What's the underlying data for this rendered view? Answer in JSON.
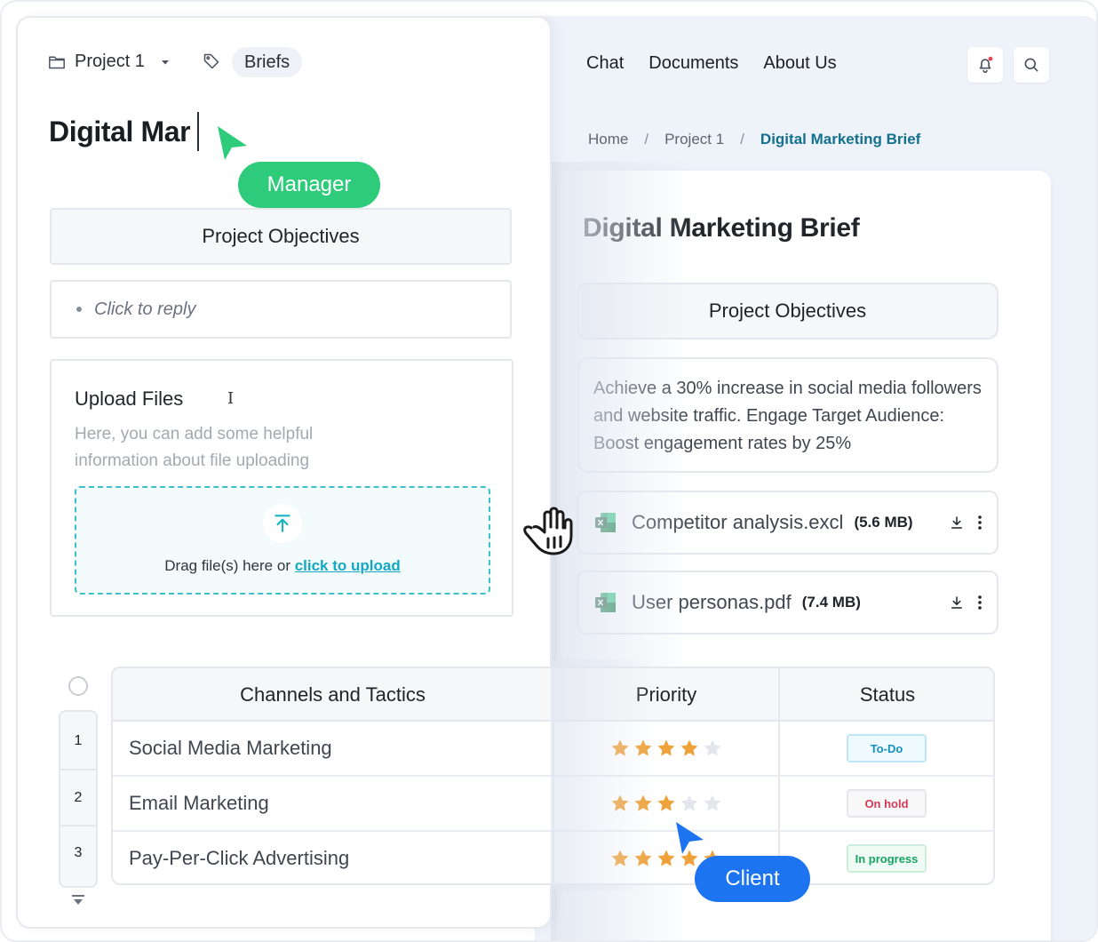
{
  "manager_view": {
    "project_selector": {
      "label": "Project 1"
    },
    "tag": {
      "label": "Briefs"
    },
    "title_input": {
      "value": "Digital Mar"
    },
    "cursor_badge": {
      "label": "Manager",
      "color": "#2ecc7a"
    },
    "objectives_heading": "Project Objectives",
    "reply_placeholder": "Click to reply",
    "upload": {
      "title": "Upload Files",
      "help_text": "Here, you can add some helpful information about file uploading",
      "drop_text": "Drag file(s) here or ",
      "drop_link": "click to upload"
    },
    "table": {
      "row_numbers": [
        "1",
        "2",
        "3"
      ],
      "columns": [
        "Channels and Tactics",
        "Priority",
        "Status"
      ],
      "rows": [
        {
          "channel": "Social Media Marketing",
          "priority": 4,
          "status": "To-Do"
        },
        {
          "channel": "Email Marketing",
          "priority": 3,
          "status": "On hold"
        },
        {
          "channel": "Pay-Per-Click Advertising",
          "priority": 5,
          "status": "In progress"
        }
      ],
      "priority_max": 5,
      "star_color": "#f0a23a",
      "star_empty_color": "#e3e6ea"
    }
  },
  "client_view": {
    "nav": {
      "items": [
        "Chat",
        "Documents",
        "About Us"
      ]
    },
    "notification_dot_color": "#e8414f",
    "breadcrumb": {
      "items": [
        "Home",
        "Project 1",
        "Digital Marketing Brief"
      ]
    },
    "title": "Digital Marketing Brief",
    "objectives_heading": "Project Objectives",
    "objectives_text": "Achieve a 30% increase in social media followers and website traffic. Engage Target Audience: Boost engagement rates by 25%",
    "files": [
      {
        "name": "Competitor analysis.excl",
        "size": "(5.6 MB)"
      },
      {
        "name": "User personas.pdf",
        "size": "(7.4 MB)"
      }
    ],
    "cursor_badge": {
      "label": "Client",
      "color": "#1c74f0"
    }
  }
}
